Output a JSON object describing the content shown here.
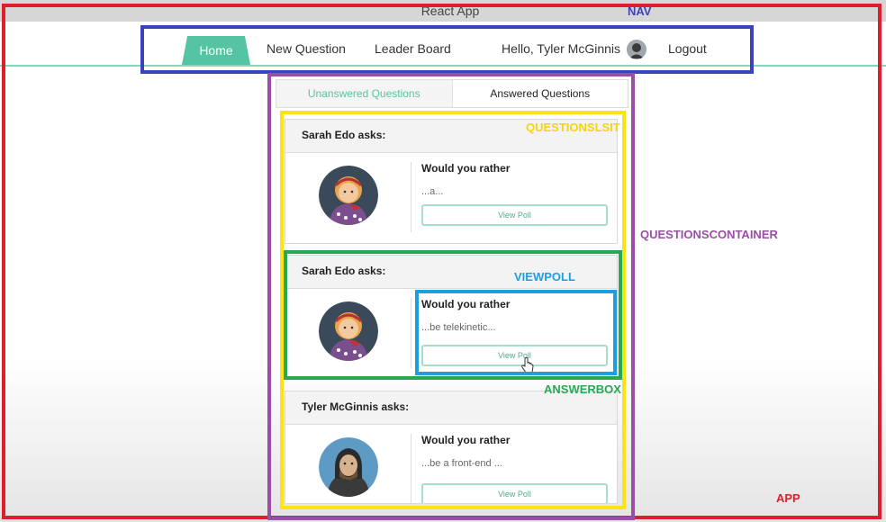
{
  "window": {
    "title": "React App"
  },
  "nav": {
    "home": "Home",
    "new_question": "New Question",
    "leader_board": "Leader Board",
    "greeting": "Hello, Tyler McGinnis",
    "logout": "Logout"
  },
  "tabs": {
    "unanswered": "Unanswered Questions",
    "answered": "Answered Questions"
  },
  "questions": [
    {
      "asker": "Sarah Edo asks:",
      "prompt": "Would you rather",
      "snippet": "...a...",
      "button": "View Poll",
      "avatar": "woman-avatar-icon"
    },
    {
      "asker": "Sarah Edo asks:",
      "prompt": "Would you rather",
      "snippet": "...be telekinetic...",
      "button": "View Poll",
      "avatar": "woman-avatar-icon"
    },
    {
      "asker": "Tyler McGinnis asks:",
      "prompt": "Would you rather",
      "snippet": "...be a front-end ...",
      "button": "View Poll",
      "avatar": "man-avatar-icon"
    }
  ],
  "annotations": {
    "nav": "NAV",
    "questionslist": "QUESTIONSLSIT",
    "questionscontainer": "QUESTIONSCONTAINER",
    "viewpoll": "VIEWPOLL",
    "answerbox": "ANSWERBOX",
    "app": "APP"
  },
  "colors": {
    "accent": "#55c4a2",
    "app_frame": "#e01e2b",
    "nav_frame": "#3c43b9",
    "container_frame": "#9a4ea5",
    "list_frame": "#fbe316",
    "viewpoll_frame": "#27a951",
    "answerbox_frame": "#1c9fe0"
  }
}
